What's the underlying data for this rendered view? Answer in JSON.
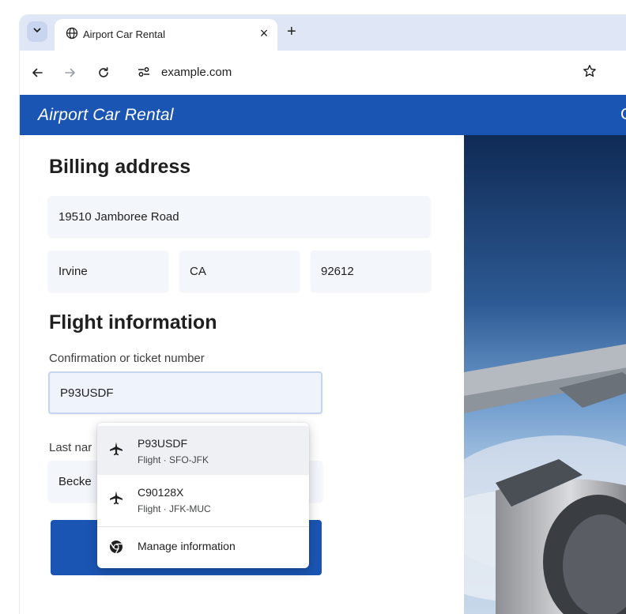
{
  "browser": {
    "tab_title": "Airport Car Rental",
    "tab_close": "×",
    "new_tab": "+",
    "url": "example.com"
  },
  "site": {
    "title": "Airport Car Rental",
    "header_edge_text": "C"
  },
  "billing": {
    "heading": "Billing address",
    "street": "19510 Jamboree Road",
    "city": "Irvine",
    "state": "CA",
    "zip": "92612"
  },
  "flight": {
    "heading": "Flight information",
    "confirmation_label": "Confirmation or ticket number",
    "confirmation_value": "P93USDF",
    "last_name_label_visible": "Last nar",
    "last_name_value_visible": "Becke"
  },
  "autofill": {
    "suggestions": [
      {
        "main": "P93USDF",
        "sub": "Flight · SFO-JFK"
      },
      {
        "main": "C90128X",
        "sub": "Flight · JFK-MUC"
      }
    ],
    "manage_label": "Manage information"
  },
  "icons": {
    "tab_search": "chevron-down-icon",
    "tab_favicon": "globe-icon",
    "back": "arrow-left-icon",
    "forward": "arrow-right-icon",
    "reload": "reload-icon",
    "site_info": "tune-icon",
    "bookmark": "star-icon",
    "suggestion": "airplane-icon",
    "manage": "chrome-icon"
  },
  "colors": {
    "brand_blue": "#1a55b4",
    "tabstrip": "#dfe6f6",
    "field_bg": "#f3f6fb"
  }
}
